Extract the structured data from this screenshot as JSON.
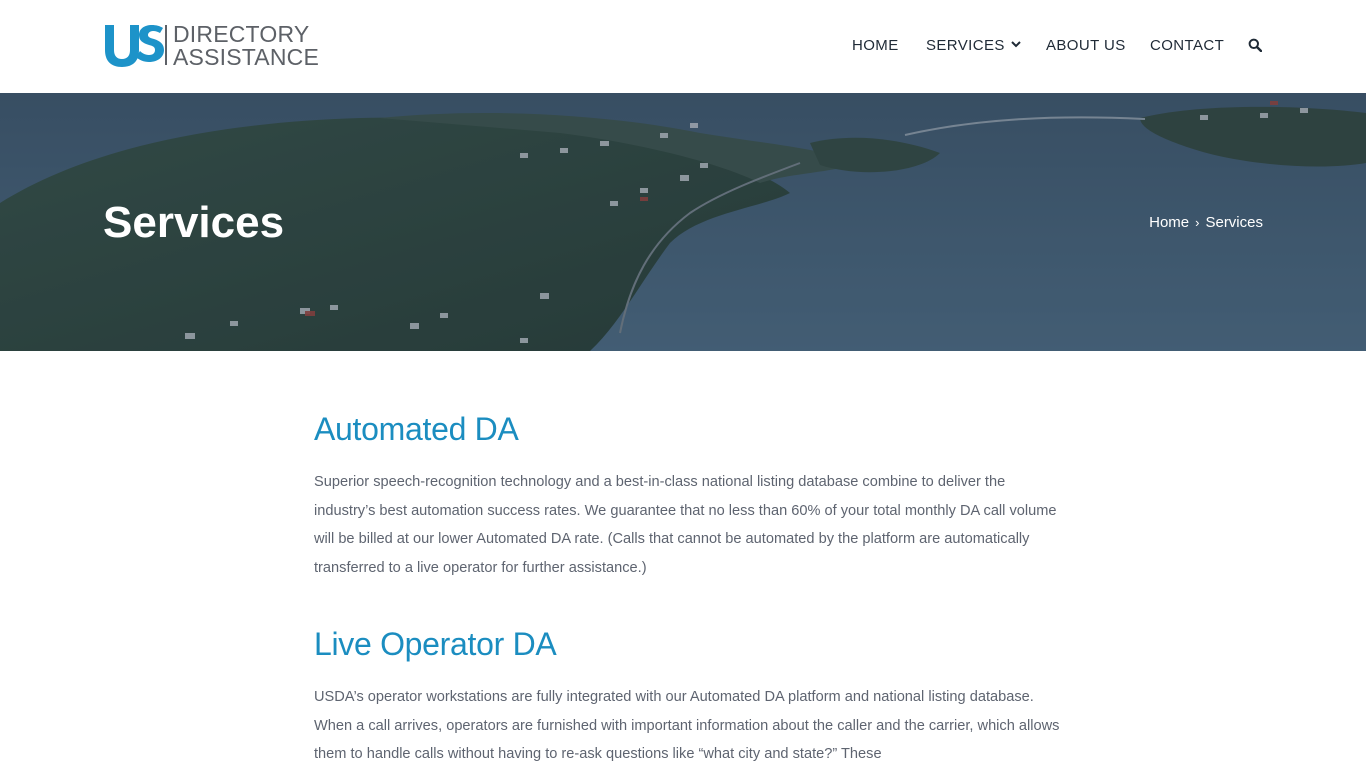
{
  "header": {
    "logo": {
      "mark": "US",
      "line1": "DIRECTORY",
      "line2": "ASSISTANCE",
      "mark_color": "#1d93c9"
    },
    "nav": {
      "home": "HOME",
      "services": "SERVICES",
      "about": "ABOUT US",
      "contact": "CONTACT"
    },
    "icons": {
      "services_dropdown": "chevron-down-icon",
      "search": "search-icon"
    }
  },
  "hero": {
    "title": "Services",
    "breadcrumb": {
      "home": "Home",
      "separator": "›",
      "current": "Services"
    }
  },
  "sections": [
    {
      "title": "Automated DA",
      "body": "Superior speech-recognition technology and a best-in-class national listing database combine to deliver the industry’s best automation success rates.  We guarantee that no less than 60% of your total monthly DA call volume will be billed at our lower Automated DA rate.  (Calls that cannot be automated by the platform are automatically transferred to a live operator for further assistance.)"
    },
    {
      "title": "Live Operator DA",
      "body": "USDA’s operator workstations are fully integrated with our Automated DA platform and national listing database.  When a call arrives, operators are furnished with important information about the caller and the carrier, which allows them to handle calls without having to re-ask questions like “what city and state?” These"
    }
  ],
  "colors": {
    "accent": "#1b8dc0",
    "body_text": "#5e6470",
    "nav_text": "#1f2a36",
    "hero_overlay": "#2c4358"
  }
}
